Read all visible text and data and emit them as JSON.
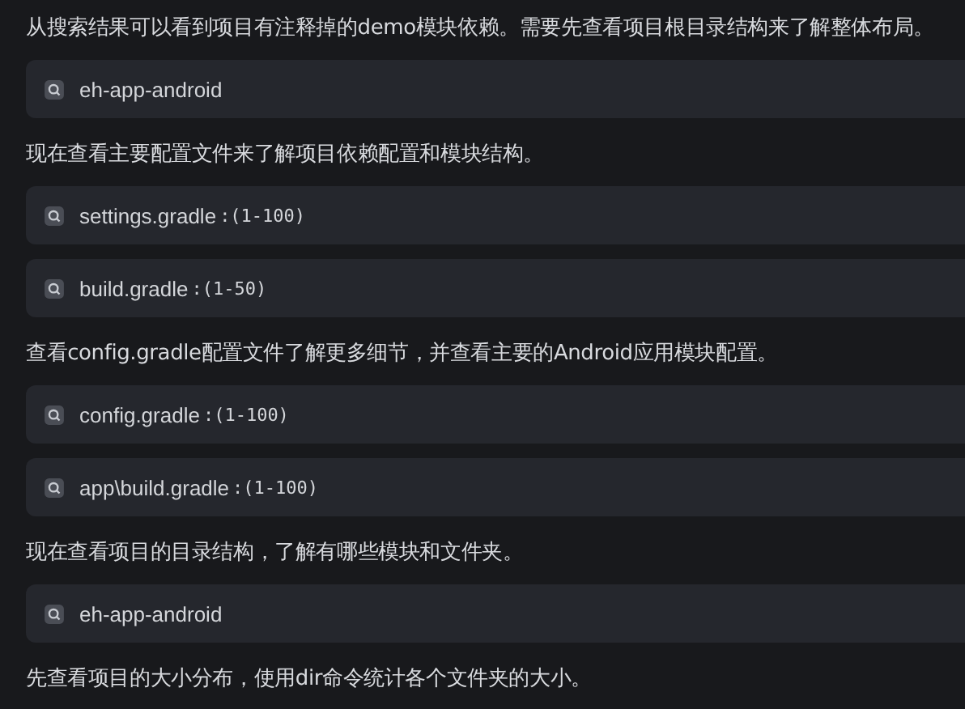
{
  "messages": [
    {
      "kind": "text",
      "text": "从搜索结果可以看到项目有注释掉的demo模块依赖。需要先查看项目根目录结构来了解整体布局。"
    },
    {
      "kind": "tool",
      "name": "eh-app-android"
    },
    {
      "kind": "text",
      "text": "现在查看主要配置文件来了解项目依赖配置和模块结构。"
    },
    {
      "kind": "tool",
      "name": "settings.gradle",
      "range": ":(1-100)"
    },
    {
      "kind": "tool",
      "name": "build.gradle",
      "range": ":(1-50)"
    },
    {
      "kind": "text",
      "text": "查看config.gradle配置文件了解更多细节，并查看主要的Android应用模块配置。"
    },
    {
      "kind": "tool",
      "name": "config.gradle",
      "range": ":(1-100)"
    },
    {
      "kind": "tool",
      "name": "app\\build.gradle",
      "range": ":(1-100)"
    },
    {
      "kind": "text",
      "text": "现在查看项目的目录结构，了解有哪些模块和文件夹。"
    },
    {
      "kind": "tool",
      "name": "eh-app-android"
    },
    {
      "kind": "text",
      "text": "先查看项目的大小分布，使用dir命令统计各个文件夹的大小。"
    }
  ]
}
